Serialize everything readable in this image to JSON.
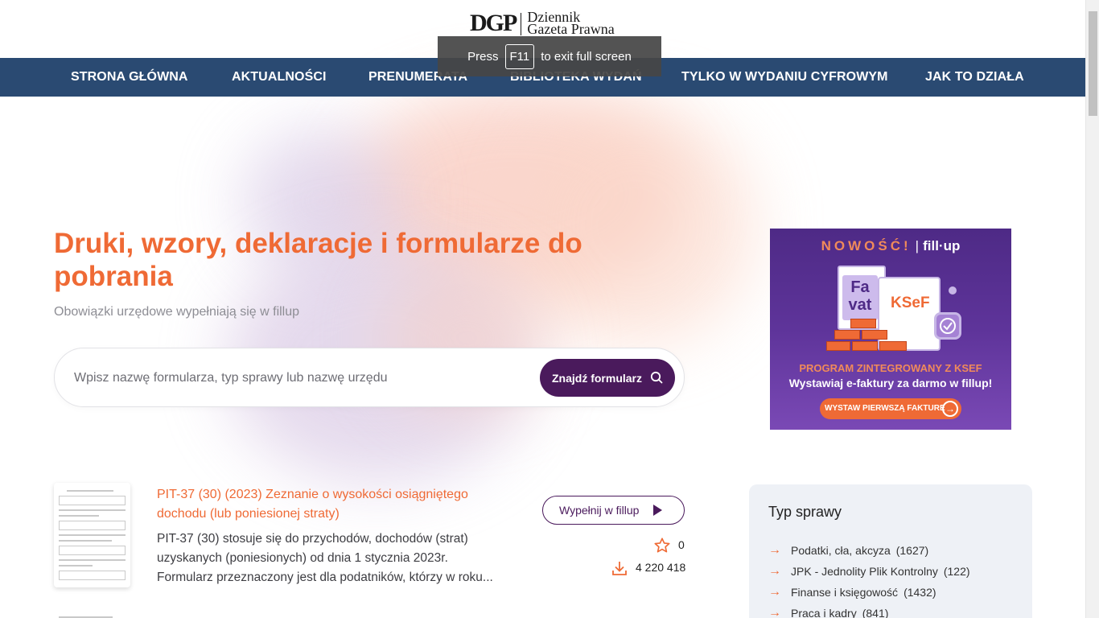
{
  "logo": {
    "mark": "DGP",
    "name_line1": "Dziennik",
    "name_line2": "Gazeta Prawna"
  },
  "toast": {
    "before": "Press",
    "key": "F11",
    "after": "to exit full screen"
  },
  "nav": {
    "items": [
      {
        "label": "STRONA GŁÓWNA"
      },
      {
        "label": "AKTUALNOŚCI"
      },
      {
        "label": "PRENUMERATA"
      },
      {
        "label": "BIBLIOTEKA WYDAŃ"
      },
      {
        "label": "TYLKO W WYDANIU CYFROWYM"
      },
      {
        "label": "JAK TO DZIAŁA"
      }
    ]
  },
  "hero": {
    "title": "Druki, wzory, deklaracje i formularze do pobrania",
    "subtitle": "Obowiązki urzędowe wypełniają się w fillup"
  },
  "search": {
    "placeholder": "Wpisz nazwę formularza, typ sprawy lub nazwę urzędu",
    "button_label": "Znajdź formularz",
    "icon": "search-icon"
  },
  "ad": {
    "badge_new": "NOWOŚĆ!",
    "brand": "fill·up",
    "card1_text": "Fa vat",
    "card2_text": "KSeF",
    "line1": "PROGRAM ZINTEGROWANY Z KSEF",
    "line2": "Wystawiaj e-faktury za darmo w fillup!",
    "button_label": "WYSTAW PIERWSZĄ FAKTURĘ",
    "colors": {
      "bg": "#5e349a",
      "accent": "#ef6a35"
    }
  },
  "results": [
    {
      "title": "PIT-37 (30) (2023) Zeznanie o wysokości osiągniętego dochodu (lub poniesionej straty)",
      "description": "PIT-37 (30) stosuje się do przychodów, dochodów (strat) uzyskanych (poniesionych) od dnia 1 stycznia 2023r. Formularz przeznaczony jest dla podatników, którzy w roku...",
      "fill_button": "Wypełnij w fillup",
      "favorites": "0",
      "downloads": "4 220 418"
    }
  ],
  "sidebar": {
    "title": "Typ sprawy",
    "items": [
      {
        "label": "Podatki, cła, akcyza",
        "count": "(1627)"
      },
      {
        "label": "JPK - Jednolity Plik Kontrolny",
        "count": "(122)"
      },
      {
        "label": "Finanse i księgowość",
        "count": "(1432)"
      },
      {
        "label": "Praca i kadry",
        "count": "(841)"
      }
    ]
  },
  "colors": {
    "accent": "#ef6a35",
    "nav_bg": "#2a4a72",
    "primary_button": "#4a1a5c"
  }
}
